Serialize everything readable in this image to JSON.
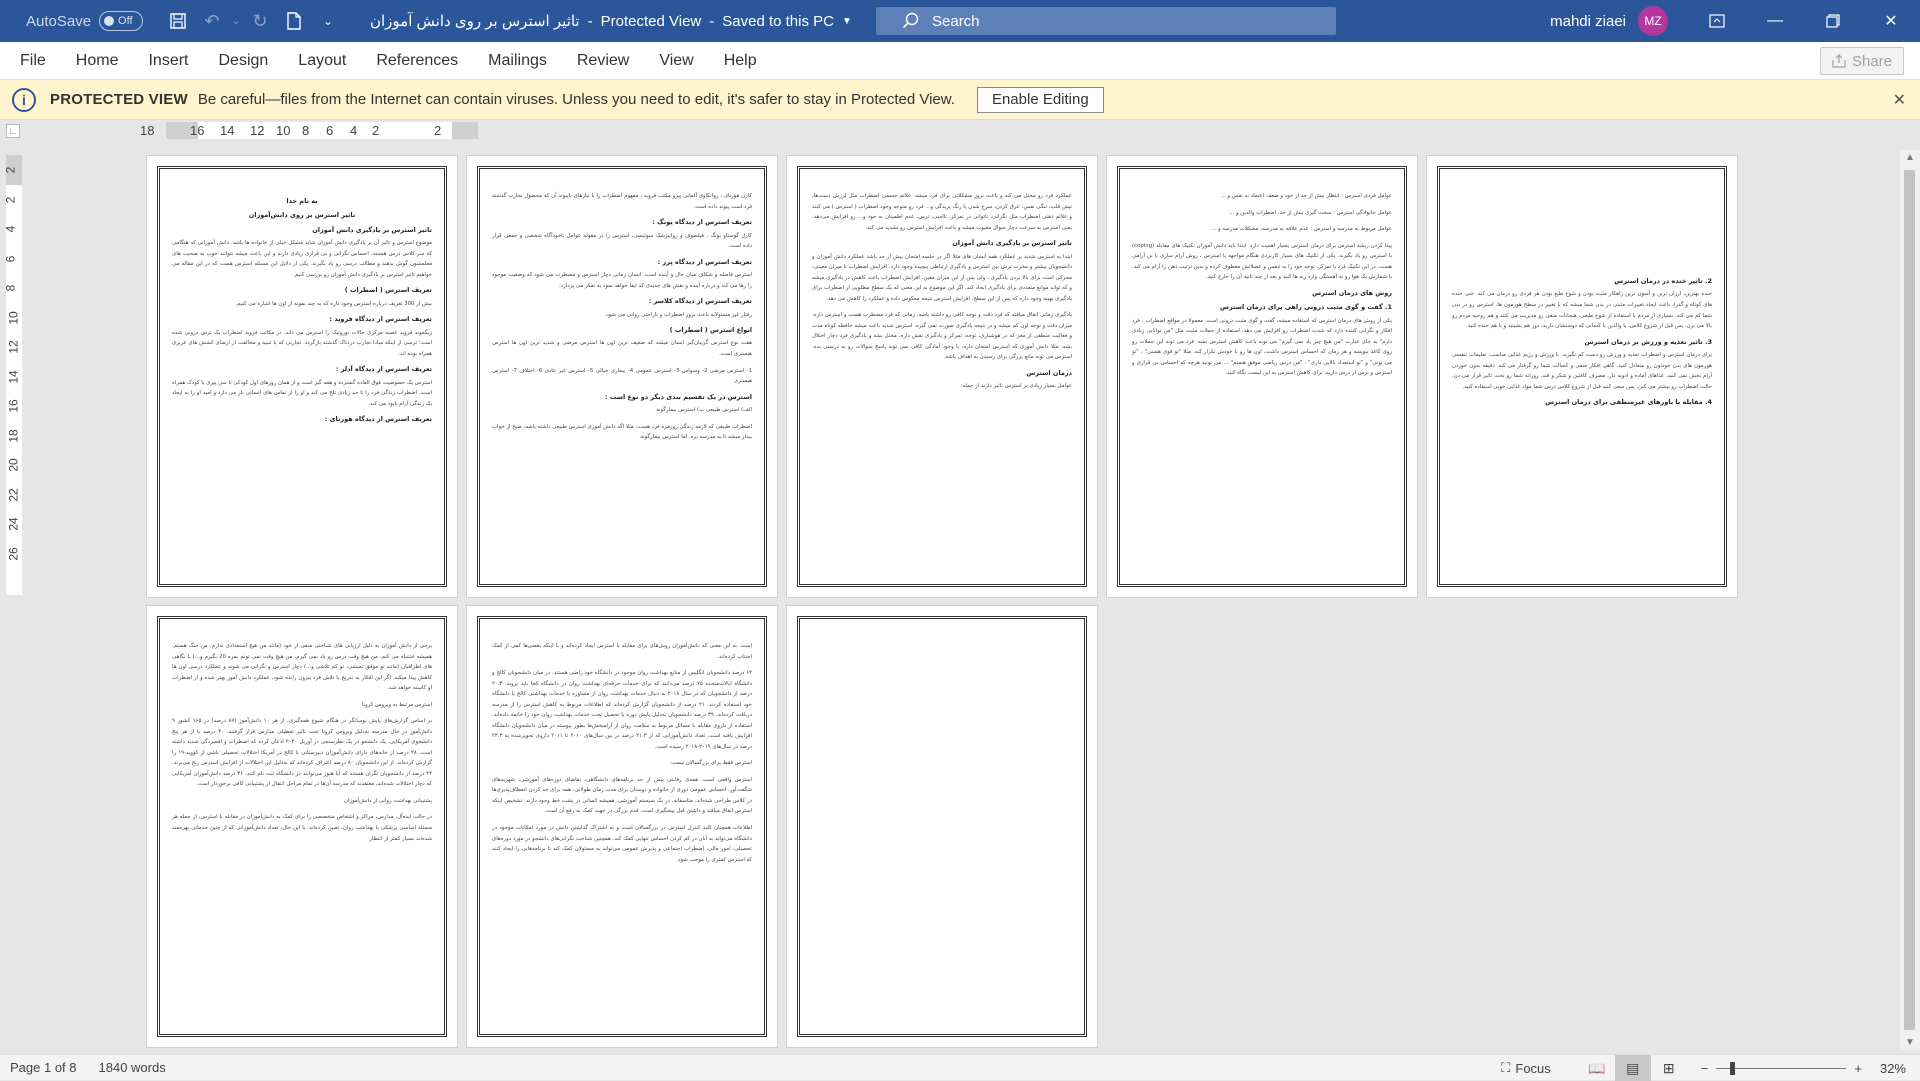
{
  "titlebar": {
    "autosave_label": "AutoSave",
    "autosave_state": "Off",
    "doc_title": "تاثیر استرس بر روی دانش آموزان",
    "separator": "-",
    "mode": "Protected View",
    "save_status": "Saved to this PC",
    "search_placeholder": "Search",
    "user_name": "mahdi ziaei",
    "user_initials": "MZ"
  },
  "menu": {
    "items": [
      "File",
      "Home",
      "Insert",
      "Design",
      "Layout",
      "References",
      "Mailings",
      "Review",
      "View",
      "Help"
    ],
    "share_label": "Share"
  },
  "protected_view": {
    "title": "PROTECTED VIEW",
    "message": "Be careful—files from the Internet can contain viruses. Unless you need to edit, it's safer to stay in Protected View.",
    "enable_button": "Enable Editing"
  },
  "ruler": {
    "horizontal_ticks": [
      "18",
      "16",
      "14",
      "12",
      "10",
      "8",
      "6",
      "4",
      "2",
      "",
      "2"
    ],
    "vertical_ticks": [
      "2",
      "2",
      "4",
      "6",
      "8",
      "10",
      "12",
      "14",
      "16",
      "18",
      "20",
      "22",
      "24",
      "26"
    ]
  },
  "pages": [
    {
      "blocks": [
        {
          "type": "head",
          "center": true,
          "text": "به نام خدا"
        },
        {
          "type": "head",
          "center": true,
          "text": "تاثیر استرس بر روی دانش‌آموزان"
        },
        {
          "type": "head",
          "text": "تاثیر استرس بر یادگیری دانش آموزان"
        },
        {
          "type": "text",
          "text": "موضوع استرس و تاثیر آن بر یادگیری دانش آموزان شاید مشکل خیلی از خانواده ها باشد. دانش آموزانی که هنگامی که سر کلاس درس هستند، احساس نگرانی و بی قراری زیادی دارند و این باعث میشه نتوانند خوب به صحبت های معلمشون گوش بدهند و مطالب درسی رو یاد بگیرند. یکی از دلایل این مسئله استرس هست که در این مقاله می خواهیم تاثیر استرس بر یادگیری دانش آموزان رو بررسی کنیم."
        },
        {
          "type": "head",
          "text": "تعریف استرس ( اضطراب )"
        },
        {
          "type": "text",
          "text": "بیش از 300 تعریف درباره استرس وجود داره که به چند نمونه از اون ها اشاره می کنیم."
        },
        {
          "type": "head",
          "text": "تعریف استرس از دیدگاه فروید :"
        },
        {
          "type": "text",
          "text": "زیگموند فروید عصبه مرکزی حالات نوروتیک را استرس می داند. در مکاتب فروید اضطراب یک ترس درونی شده است؛ ترسی از اینکه مبادا تجارب دردناک گذشته بازگردد. تجاربی که با تنبیه و مخالفت از ارضای کشش های غریزی همراه بوده اند."
        },
        {
          "type": "head",
          "text": "تعریف استرس از دیدگاه آدلر :"
        },
        {
          "type": "text",
          "text": "استرس یک خصوصیت فوق العاده گسترده و همه گیر است و از همان روزهای اول کودکی تا سن پیری با کودک همراه است. اضطراب زندگی فرد را تا حد زیادی تلخ می کند و او را از تماس های انسانی باز می دارد و امید او را به ایجاد یک زندگی آرام نابود می کند."
        },
        {
          "type": "head",
          "text": "تعریف استرس از دیدگاه هورنای :"
        }
      ]
    },
    {
      "blocks": [
        {
          "type": "text",
          "text": "کارن هورنای ، روانکاوی آلمانی پیرو مکتب فروید ، مفهوم اضطراب را با نیازهای ناپیوند آن که محصول تجارب گذشته فرد است پیوند داده است."
        },
        {
          "type": "head",
          "text": "تعریف استرس از دیدگاه یونگ :"
        },
        {
          "type": "text",
          "text": "کارل گوستاو یونگ ، فیلسوف و روانپزشک سوئیسی، استرس را در مقوله عوامل ناخودآگاه شخصی و جمعی قرار داده است."
        },
        {
          "type": "head",
          "text": "تعریف استرس از دیدگاه پرز :"
        },
        {
          "type": "text",
          "text": "استرس فاصله و شکاف میان حال و آینده است. انسان زمانی دچار استرس و مضطرب می شود که وضعیت موجود را رها می کند و درباره آینده و نقش های جدیدی که ایفا خواهد نمود به تفکر می پردازد."
        },
        {
          "type": "head",
          "text": "تعریف استرس از دیدگاه کلاسر :"
        },
        {
          "type": "text",
          "text": "رفتار غیر مسئولانه باعث بروز اضطراب و ناراحتی روانی می شود."
        },
        {
          "type": "head",
          "text": "انواع استرس ( اضطراب )"
        },
        {
          "type": "text",
          "text": "هفت نوع استرس گریبان‌گیر انسان میشه که ضعیف ترین اون ها استرس مرضی و شدید ترین اون ها استرس هیستری است."
        },
        {
          "type": "text",
          "text": "1- استرس مرضی  2- وسواس  3- استرس عمومی  4- بیماری خیالی  5- استرس غیر عادی  6- اختلاف  7- استرس هیستری"
        },
        {
          "type": "head",
          "text": "استرس در یک تقسیم بندی دیگر دو نوع است :"
        },
        {
          "type": "text",
          "text": "الف) استرس طبیعی   ب) استرس بیمارگونه"
        },
        {
          "type": "text",
          "text": "اضطراب طبیعی که لازمه زندگی روزمره فرد هست. مثلا اگه دانش آموزی استرس طبیعی داشته باشه، صبح از خواب بیدار میشه تا به مدرسه بره. اما استرس بیمارگونه"
        }
      ]
    },
    {
      "blocks": [
        {
          "type": "text",
          "text": "عملکرد فرد رو مختل می کنه و باعث بروز مشکلاتی برای فرد میشه. علائم جسمی اضطراب مثل لرزش دست‌ها، تپش قلب، تنگی نفس، عرق کردن، سرخ شدن یا رنگ پریدگی و... فرد رو متوجه وجود اضطراب ( استرس ) می کنند و علائم ذهنی اضطراب مثل نگرانی، ناتوانی در تمرکز، ناامنی، ترس، عدم اطمینان به خود و... رو افزایش می‌دهد. یعنی استرس به سرعت دچار سوال معیوب میشه و باعث افزایش استرس رو تشدید می کند."
        },
        {
          "type": "head",
          "text": "تاثیر استرس بر یادگیری دانش آموزان"
        },
        {
          "type": "text",
          "text": "ابتدا به استرس شدید بر عملکرد همه انسان های مثلا اگر در جلسه امتحان بیش از حد باشد عملکرد دانش آموزان و دانشجویان بیشتر و مخرب ترش بین استرس و یادگیری ارتباطی پیچیده وجود دارد. افزایش اضطراب تا میزان معینی، محرکی است برای بالا بردن یادگیری ، ولی پس از این میزان معین، افزایش اضطراب باعث کاهش در یادگیری میشه و که تواند موانع متعددی برای یادگیری ایجاد کند. اگر این موضوع به این معنی که یک سطح مطلوبی از اضطراب برای یادگیری بهینه وجود داره که پس از این سطح، افزایش استرس نتیجه معکوس داده و عملکرد را کاهش می دهد."
        },
        {
          "type": "text",
          "text": "یادگیری زمانی اتفاق میافته که فرد دقت و توجه کافی رو داشته باشه. زمانی که فرد مضطرب هست و استرس داره، میزان دقت و توجه اون کم میشه و در نتیجه یادگیری صورت نمی گیره. استرس شدید باعث میشه حافظه کوتاه مدت و فعالیت منطقی از مغز که در هوشیاری، توجه، تمرکز و یادگیری نقش داره، مختل بشه و یادگیری فرد دچار اختلال بشه. مثلا دانش آموزی که استرس امتحان داره، با وجود آمادگی کافی نمی تونه پاسخ سوالات رو به درستی بده. استرس می تونه مانع بزرگی برای رسیدن به اهداف باشه."
        },
        {
          "type": "head",
          "text": "درمان استرس"
        },
        {
          "type": "text",
          "text": "عوامل بسیار زیادی بر استرس تاثیر دارند از جمله:"
        }
      ]
    },
    {
      "blocks": [
        {
          "type": "text",
          "text": "عوامل فردی استرس : انتظار بیش از حد از خود و ضعف اعتماد به نفس و ..."
        },
        {
          "type": "text",
          "text": "عوامل خانوادگی استرس : سخت گیری بیش از حد، اضطراب والدین و ..."
        },
        {
          "type": "text",
          "text": "عوامل مربوط به مدرسه و استرس : عدم علاقه به مدرسه، مشکلات مدرسه و ..."
        },
        {
          "type": "text",
          "text": "پیدا کردن ریشه استرس برای درمان استرس بسیار اهمیت دارد. ابتدا باید دانش آموزان تکنیک های مقابله (coping) با استرس رو یاد بگیرند. یکی از تکنیک های بسیار کاربردی هنگام مواجهه با استرس ، روش آرام سازی یا تن آرامی هست. در این تکنیک فرد با تمرکز، توجه خود را به تنفس و عضلاتش معطوف کرده و بدین ترتیب ذهن را آرام می کند. با شمارش یک هوا رو به آهستگی وارد ریه ها کنید و بعد از چند ثانیه آن را خارج کنید."
        },
        {
          "type": "head",
          "text": "روش های درمان استرس"
        },
        {
          "type": "head",
          "text": "1. گفت و گوی مثبت درونی راهی برای درمان استرس"
        },
        {
          "type": "text",
          "text": "یکی از روش های درمان استرس که استفاده میشه، گفت و گوی مثبت درونی است. معمولا در مواقع اضطراب ، فرد افکار و نگرانی کننده دارد که شدت اضطراب رو افزایش می دهد. استفاده از جملات مثبت مثل \"من توانایی زیادی دارم\" به جای عبارت \"من هیچ چیز یاد نمی گیرم\" می تونه باعث کاهش استرس بشه. فرد می تونه این جملات رو روی کاغذ بنویسه و هر زمان که احساس استرس داشت، اون ها رو با خودش تکرار کنه. مثلا \"تو قوی هستی\" ، \"تو می تونی\" و \"تو استعداد بالایی داری\" ، \"من درس ریاضی موفق هستم\" ... می تونید هرچه که احساس بی قراری و استرس و ترس از درس دارید، برای کاهش استرس به این لیست نگاه کنید."
        }
      ]
    },
    {
      "blocks": [
        {
          "type": "spacer"
        },
        {
          "type": "head",
          "text": "2. تاثیر خنده در درمان استرس"
        },
        {
          "type": "text",
          "text": "خنده بهترین، ارزان ترین و آسون ترین راهکار مثبت بودن و شوخ طبع بودن هر فردی رو درمان می کنه. حتی خنده های کوتاه و گذرا، باعث ایجاد تغییرات مثبتی در بدن شما میشه که با تغییر در سطح هورمون ها، استرس رو در بدن شما کم می کنه. بسیاری از مردم با استفاده از شوخ طبعی، هیجانات منفی رو مدیریت می کنند و هم روحیه مردم رو بالا می برن. پس قبل از شروع کلاس، با والدین یا کسانی که دوستشان دارید، دور هم بشینید و با هم خنده کنید."
        },
        {
          "type": "head",
          "text": "3. تاثیر تغذیه و ورزش بر درمان استرس"
        },
        {
          "type": "text",
          "text": "برای درمان استرس و اضطراب تغذیه و ورزش رو دست کم نگیرید. با ورزش و رژیم غذایی مناسب، تعلیمات تنفسی هورمون های بدن خودتون رو متعادل کنید. گاهی افکار منفی و کسالت شما رو گرفتار می کنه. دقیقه بدون خوردن آرام بخش نمی کنید. غذاهای آماده و ادویه دار، مصرف کافئین و شکر و قند، روزانه شما رو تحت تاثیر قرار می دن. حالت اضطراب رو بیشتر می کنن. پس سعی کنید قبل از شروع کلاس درس شما مواد غذایی خوبی استفاده کنید."
        },
        {
          "type": "head",
          "text": "4. مقابله با باورهای غیرمنطقی برای درمان استرس"
        }
      ]
    },
    {
      "blocks": [
        {
          "type": "text",
          "text": "برخی از دانش آموزان به دلیل ارزیابی های شناختی منفی از خود (مانند من هیچ استعدادی ندارم، من خنگ هستم، همیشه اشتباه می کنم، من هیچ وقت درس رو یاد نمی گیرم، من هیچ وقت نمی تونم نمره 20 بگیرم و...) یا نگاهی های اطرافیان (مانند تو موفق نمیشی، تو کم تلاشی و...) دچار استرس و نگرانی می شوند و عملکرد درسی اون ها کاهش پیدا میکنه. اگر این افکار به تدریج با تلاش فرد بیرون رانده شود، عملکرد دانش آموز بهتر شده و از اضطراب او کاسته خواهد شد."
        },
        {
          "type": "text",
          "text": "استرس مرتبط به ویروس کرونا"
        },
        {
          "type": "text",
          "text": "بر اساس گزارش‌های پایش نوسانگر در هنگام شیوع همه‌گیری، از هر ۱۰ دانش‌آموز (۸۷ درصد) در ۱۶۵ کشور ۹ دانش‌آموز در حال مدرسه به‌دلیل ویروس کرونا تحت تاثیر تعطیلی مدارس قرار گرفتند. ۴۰ درصد یا از هر پنج دانشجوی آمریکایی، یک دانشجو در یک نظرسنجی در آوریل ۲۰۲۰ اذعان کرده که اضطراب و افسردگی شدید داشته است. ۲۸ درصد از خانه‌های دارای دانش‌آموزان دبیرستانی با کالج در آمریکا اختلالات تحصیلی ناشی از کووید-۱۹ را گزارش کرده‌اند. از این دانشجویان ۸۰ درصد اعتراف کرده‌اند که به‌دلیل این اختلالات از افزایش استرس رنج می‌برند. ۴۴ درصد از دانشجویان نگران هستند که آیا هنوز می‌توانند در دانشگاه ثبت نام کنند. ۳۶ درصد دانش‌آموزان آمریکایی که دچار اختلالات شده‌اند، معتقدند که مدرسه آن‌ها در تمام مراحل انتقال از پشتیبانی کافی برخوردار است."
        },
        {
          "type": "text",
          "text": "پشتیبانی بهداشت روانی از دانش‌آموزان"
        },
        {
          "type": "text",
          "text": "در حالت ایده‌آل، مدارس، مراکز و اشخاص متخصصی را برای کمک به دانش‌آموزان در مقابله با استرس، از جمله هر مسئله اساسی پزشکی یا بهداشت روان، تعیین کرده‌اند. با این حال، تعداد دانش‌آموزانی که از چنین خدماتی بهره‌مند شده‌اند بسیار کمتر از انتظار"
        }
      ]
    },
    {
      "blocks": [
        {
          "type": "text",
          "text": "است. به این معنی که دانش‌آموزان روش‌های برای مقابله با استرس ایجاد کرده‌اند و با اینکه بعضی‌ها کمی از کمک اجتناب کرده‌اند."
        },
        {
          "type": "text",
          "text": "۶۲ درصد دانشجویان انگلیس از منابع بهداشت روان موجود در دانشگاه خود راضی هستند. در میان دانشجویان کالج و دانشگاه ایالات‌متحده ۷۵ درصد می‌دانند که برای خدمات حرفه‌ای بهداشت روان در دانشگاه کجا باید بروند. ۲۰.۳ درصد از دانشجویان که در سال ۲۰۱۸ به دنبال خدمات بهداشت روان از مشاوره یا خدمات بهداشتی کالج یا دانشگاه خود استفاده کردند. ۲۱ درصد از دانشجویان گزارش کرده‌اند که اطلاعات مربوط به کاهش استرس را از مدرسه دریافت کرده‌اند. ۳۹ درصد دانشجویان به‌دلیل پایش دوره یا تحصیل تحت خدمات بهداشت روان خود را خاتمه داده‌اند. استفاده از داروی مقابله با مسائل مربوط به سلامت روان از آرامبخش‌ها بطور پیوسته در میان دانشجویان دانشگاه افزایش یافته است. تعداد دانش‌آموزانی که از ۲۱.۳ درصد در بین سال‌های ۲۰۱۰ تا ۲۰۱۱ داروی تجویز‌شده به ۲۴.۳ درصد در سال‌های ۲۰۱۹-۲۰۱۸ رسیده است."
        },
        {
          "type": "text",
          "text": "استرس فقط برای بزرگسالان نیست"
        },
        {
          "type": "text",
          "text": "استرس واقعی است. همه‌ی رقابتی بیش از حد برنامه‌های دانشگاهی، تقاضای دوره‌های آموزشی، شهریه‌های شگفت‌آور، احساس عمومی دوری از خانواده و دوستان برای مدت زمان طولانی، همه برای حد کردن انعطاف‌پذیری‌ها در کلاس طراحی شده‌اند. متاسفانه، در یک سیستم آموزشی، همیشه کسانی در پشت خط وجود دارند. تشخیص اینکه استرس اتفاق میافتد و داشتن قبل پیشگیری است، قدم بزرگی در جهت کمک به رفع آن است."
        },
        {
          "type": "text",
          "text": "اطلاعات همچنان کلید کنترل استرس در بزرگسالان است و به اشتراک گذاشتن دانش در مورد امکانات موجود در دانشگاه می‌تواند به آنان در کم کردن احساس تنهایی کمک کند. همچنین شناخت نگرانی‌های دانشجو در مورد دوره‌های تحصیلی، امور مالی، اضطراب اجتماعی و پذیرش عمومی می‌تواند به مسئولان کمک کند تا برنامه‌هایی را ایجاد کنند که استرس کمتری را موجب شود."
        }
      ]
    },
    {
      "blocks": []
    }
  ],
  "status": {
    "page_info": "Page 1 of 8",
    "word_count": "1840 words",
    "focus_label": "Focus",
    "zoom_percent": "32%",
    "zoom_value": 32
  }
}
